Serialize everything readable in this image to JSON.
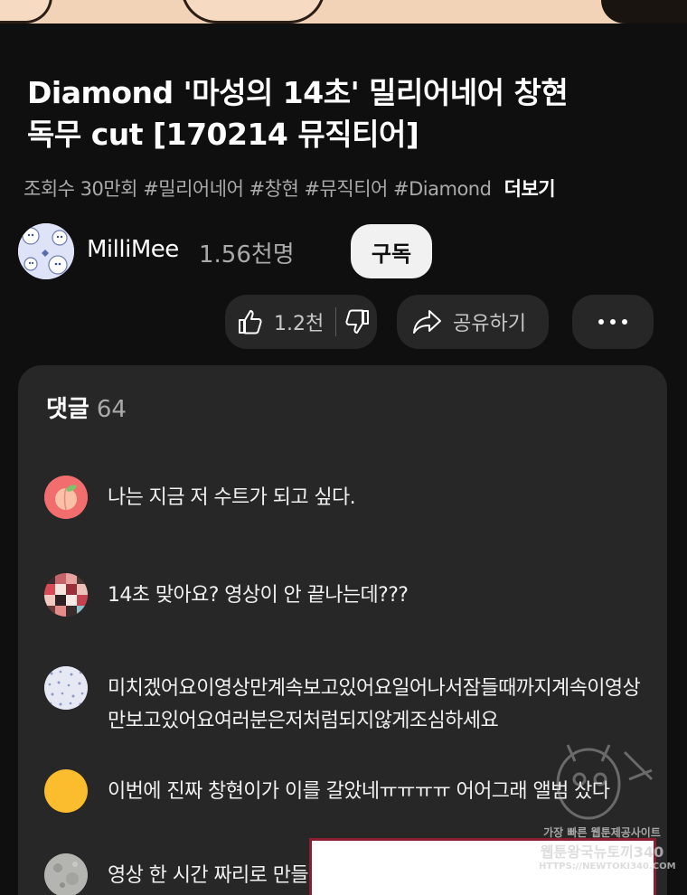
{
  "video": {
    "title_line1": "Diamond '마성의 14초' 밀리어네어 창현",
    "title_line2": "독무 cut [170214 뮤직티어]",
    "views": "조회수 30만회",
    "hashtags": "#밀리어네어 #창현 #뮤직티어 #Diamond",
    "more_label": "더보기"
  },
  "channel": {
    "name": "MilliMee",
    "subscribers": "1.56천명",
    "subscribe_label": "구독"
  },
  "actions": {
    "like_count": "1.2천",
    "share_label": "공유하기"
  },
  "comments": {
    "heading": "댓글",
    "count": "64",
    "items": [
      {
        "text": "나는 지금 저 수트가 되고 싶다.",
        "avatar": "peach-avatar"
      },
      {
        "text": "14초 맞아요? 영상이 안 끝나는데???",
        "avatar": "mosaic-avatar"
      },
      {
        "text": "미치겠어요이영상만계속보고있어요일어나서잠들때까지계속이영상만보고있어요여러분은저처럼되지않게조심하세요",
        "avatar": "pattern-avatar"
      },
      {
        "text": "이번에 진짜 창현이가 이를 갈았네ㅠㅠㅠㅠ 어어그래 앨범 샀다",
        "avatar": "yellow-avatar"
      },
      {
        "text": "영상 한 시간 짜리로 만들",
        "avatar": "moon-avatar"
      }
    ]
  },
  "watermark": {
    "line1": "가장 빠른 웹툰제공사이트",
    "line2": "웹툰왕국뉴토끼340",
    "line3": "HTTPS://NEWTOKI340.COM"
  },
  "colors": {
    "background": "#0f0f0f",
    "surface": "#272727",
    "secondary_text": "#aaaaaa",
    "subscribe_bg": "#f1f1f1"
  }
}
